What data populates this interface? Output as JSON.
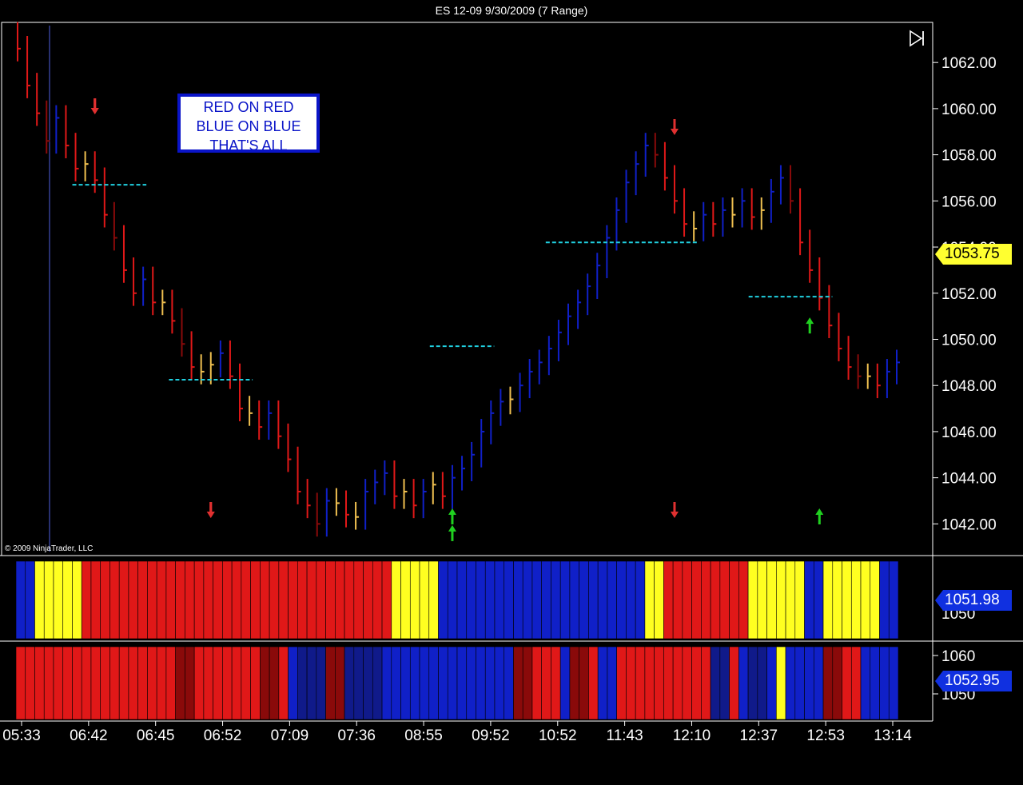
{
  "window": {
    "title": "ES 12-09  9/30/2009 (7 Range)"
  },
  "note": {
    "lines": [
      "RED ON RED",
      "BLUE ON BLUE",
      "THAT'S ALL"
    ]
  },
  "copyright": "© 2009 NinjaTrader, LLC",
  "colors": {
    "background": "#000000",
    "up_bar": "#1020c8",
    "down_bar": "#e01818",
    "dark_red": "#8a0a0a",
    "dark_blue": "#101a8a",
    "neutral_bar": "#f0c050",
    "level_line": "#20d0e0",
    "short_arrow": "#e03030",
    "long_arrow": "#20d020",
    "price_tag": "#ffff30",
    "indicator_tag": "#1030e0"
  },
  "icons": {
    "skip_to_end": "skip-to-end-icon"
  },
  "chart_data": [
    {
      "type": "ohlc",
      "name": "price-panel",
      "ylim": [
        1040.8,
        1063.6
      ],
      "yticks": [
        "1062.00",
        "1060.00",
        "1058.00",
        "1056.00",
        "1054.00",
        "1052.00",
        "1050.00",
        "1048.00",
        "1046.00",
        "1044.00",
        "1042.00"
      ],
      "last_price": "1053.75",
      "bars_count": 92,
      "closes": [
        1062.6,
        1061.0,
        1059.8,
        1058.6,
        1059.6,
        1058.4,
        1057.4,
        1057.6,
        1056.9,
        1055.4,
        1054.4,
        1053.0,
        1052.0,
        1052.6,
        1051.6,
        1051.6,
        1050.8,
        1049.8,
        1048.8,
        1048.6,
        1048.9,
        1049.4,
        1048.4,
        1047.0,
        1046.8,
        1046.2,
        1046.8,
        1045.8,
        1044.8,
        1043.4,
        1042.8,
        1042.0,
        1043.0,
        1042.9,
        1042.4,
        1042.3,
        1043.4,
        1043.8,
        1044.2,
        1043.2,
        1043.4,
        1042.8,
        1043.4,
        1043.7,
        1043.2,
        1044.0,
        1044.4,
        1045.0,
        1046.0,
        1046.8,
        1047.3,
        1047.4,
        1048.0,
        1048.6,
        1049.0,
        1049.6,
        1050.3,
        1051.0,
        1051.6,
        1052.3,
        1053.2,
        1054.4,
        1055.6,
        1056.8,
        1057.6,
        1058.4,
        1058.0,
        1057.0,
        1056.0,
        1055.0,
        1054.8,
        1055.4,
        1055.0,
        1055.6,
        1055.4,
        1056.0,
        1055.3,
        1055.6,
        1056.4,
        1057.0,
        1056.0,
        1054.2,
        1053.0,
        1051.8,
        1050.6,
        1049.6,
        1048.8,
        1048.4,
        1048.4,
        1048.0,
        1048.6,
        1049.0
      ],
      "levels": [
        {
          "price": 1056.7,
          "from_bar": 6,
          "to_bar": 13
        },
        {
          "price": 1048.25,
          "from_bar": 16,
          "to_bar": 24
        },
        {
          "price": 1049.7,
          "from_bar": 43,
          "to_bar": 49
        },
        {
          "price": 1054.2,
          "from_bar": 55,
          "to_bar": 70
        },
        {
          "price": 1051.85,
          "from_bar": 76,
          "to_bar": 84
        }
      ],
      "signals": [
        {
          "bar": 8,
          "dir": "down"
        },
        {
          "bar": 20,
          "dir": "down"
        },
        {
          "bar": 8,
          "dir": "down"
        },
        {
          "bar": 20,
          "dir": "down"
        },
        {
          "bar": 45,
          "dir": "up"
        },
        {
          "bar": 45,
          "dir": "up"
        },
        {
          "bar": 68,
          "dir": "down"
        },
        {
          "bar": 68,
          "dir": "down"
        },
        {
          "bar": 82,
          "dir": "up"
        },
        {
          "bar": 83,
          "dir": "up"
        }
      ]
    },
    {
      "type": "heatmap",
      "name": "indicator-panel-1",
      "value_label": "1051.98",
      "axis_label": "1050",
      "cells": [
        "blue",
        "blue",
        "yellow",
        "yellow",
        "yellow",
        "yellow",
        "yellow",
        "red",
        "red",
        "red",
        "red",
        "red",
        "red",
        "red",
        "red",
        "red",
        "red",
        "red",
        "red",
        "red",
        "red",
        "red",
        "red",
        "red",
        "red",
        "red",
        "red",
        "red",
        "red",
        "red",
        "red",
        "red",
        "red",
        "red",
        "red",
        "red",
        "red",
        "red",
        "red",
        "red",
        "yellow",
        "yellow",
        "yellow",
        "yellow",
        "yellow",
        "blue",
        "blue",
        "blue",
        "blue",
        "blue",
        "blue",
        "blue",
        "blue",
        "blue",
        "blue",
        "blue",
        "blue",
        "blue",
        "blue",
        "blue",
        "blue",
        "blue",
        "blue",
        "blue",
        "blue",
        "blue",
        "blue",
        "yellow",
        "yellow",
        "red",
        "red",
        "red",
        "red",
        "red",
        "red",
        "red",
        "red",
        "red",
        "yellow",
        "yellow",
        "yellow",
        "yellow",
        "yellow",
        "yellow",
        "blue",
        "blue",
        "yellow",
        "yellow",
        "yellow",
        "yellow",
        "yellow",
        "yellow",
        "blue",
        "blue"
      ]
    },
    {
      "type": "heatmap",
      "name": "indicator-panel-2",
      "value_label": "1052.95",
      "axis_labels": [
        "1060",
        "1050"
      ],
      "cells": [
        "red",
        "red",
        "red",
        "red",
        "red",
        "red",
        "red",
        "red",
        "red",
        "red",
        "red",
        "red",
        "red",
        "red",
        "red",
        "red",
        "red",
        "darkred",
        "darkred",
        "red",
        "red",
        "red",
        "red",
        "red",
        "red",
        "red",
        "darkred",
        "darkred",
        "red",
        "blue",
        "darkblue",
        "darkblue",
        "darkblue",
        "darkred",
        "darkred",
        "darkblue",
        "darkblue",
        "darkblue",
        "darkblue",
        "blue",
        "blue",
        "blue",
        "blue",
        "blue",
        "blue",
        "blue",
        "blue",
        "blue",
        "blue",
        "blue",
        "blue",
        "blue",
        "blue",
        "darkred",
        "darkred",
        "red",
        "red",
        "red",
        "blue",
        "darkred",
        "darkred",
        "red",
        "blue",
        "blue",
        "red",
        "red",
        "red",
        "red",
        "red",
        "red",
        "red",
        "red",
        "red",
        "red",
        "darkblue",
        "darkblue",
        "red",
        "blue",
        "darkblue",
        "darkblue",
        "blue",
        "yellow",
        "blue",
        "blue",
        "blue",
        "blue",
        "darkred",
        "darkred",
        "red",
        "red",
        "blue",
        "blue",
        "blue",
        "blue"
      ]
    },
    {
      "type": "time-axis",
      "labels": [
        "05:33",
        "06:42",
        "06:45",
        "06:52",
        "07:09",
        "07:36",
        "08:55",
        "09:52",
        "10:52",
        "11:43",
        "12:10",
        "12:37",
        "12:53",
        "13:14"
      ]
    }
  ]
}
